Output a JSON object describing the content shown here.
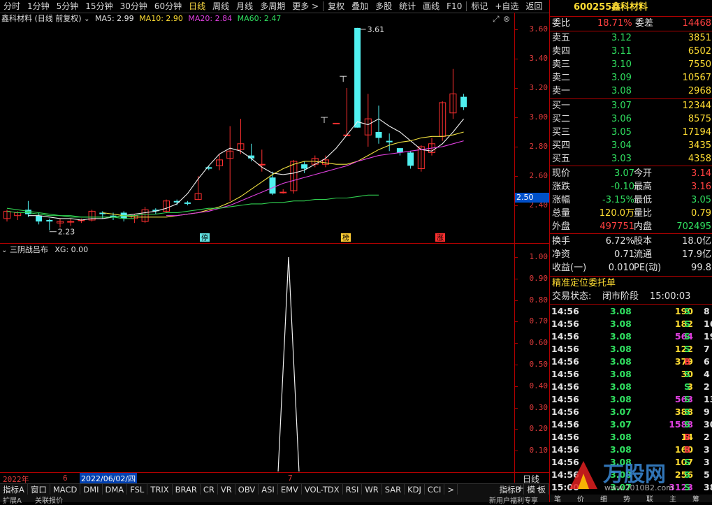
{
  "toolbar": {
    "items": [
      "分时",
      "1分钟",
      "5分钟",
      "15分钟",
      "30分钟",
      "60分钟",
      "日线",
      "周线",
      "月线",
      "多周期",
      "更多 >",
      "复权",
      "叠加",
      "多股",
      "统计",
      "画线",
      "F10",
      "标记",
      "+自选",
      "返回"
    ],
    "active": "日线"
  },
  "main_legend": {
    "title": "鑫科材料 (日线 前复权)",
    "ma5": "MA5: 2.99",
    "ma10": "MA10: 2.90",
    "ma20": "MA20: 2.84",
    "ma60": "MA60: 2.47"
  },
  "main_axis": [
    "3.60",
    "3.40",
    "3.20",
    "3.00",
    "2.80",
    "2.60",
    "2.40"
  ],
  "current_price_tag": "2.50",
  "annotations": {
    "high": "3.61",
    "low": "2.23",
    "tag1": "停",
    "tag2": "榜",
    "tag3": "涨"
  },
  "sub_legend": {
    "title": "三阴战吕布",
    "value": "XG: 0.00"
  },
  "sub_axis": [
    "1.00",
    "0.90",
    "0.80",
    "0.70",
    "0.60",
    "0.50",
    "0.40",
    "0.30",
    "0.20",
    "0.10"
  ],
  "date_bar": {
    "year": "2022年",
    "m1": "6",
    "date": "2022/06/02/四",
    "m2": "7",
    "period": "日线"
  },
  "indicator_tabs": [
    "指标A",
    "窗口",
    "MACD",
    "DMI",
    "DMA",
    "FSL",
    "TRIX",
    "BRAR",
    "CR",
    "VR",
    "OBV",
    "ASI",
    "EMV",
    "VOL-TDX",
    "RSI",
    "WR",
    "SAR",
    "KDJ",
    "CCI",
    ">",
    "指标B",
    "模 板"
  ],
  "status_bar": {
    "left": "扩展A",
    "mid": "关联报价",
    "right": "新用户福利专享"
  },
  "quote": {
    "code": "600255",
    "name": "鑫科材料",
    "webi_label": "委比",
    "webi": "18.71%",
    "wecha_label": "委差",
    "wecha": "14468",
    "asks": [
      {
        "label": "卖五",
        "price": "3.12",
        "vol": "3851"
      },
      {
        "label": "卖四",
        "price": "3.11",
        "vol": "6502"
      },
      {
        "label": "卖三",
        "price": "3.10",
        "vol": "7550"
      },
      {
        "label": "卖二",
        "price": "3.09",
        "vol": "10567"
      },
      {
        "label": "卖一",
        "price": "3.08",
        "vol": "2968"
      }
    ],
    "bids": [
      {
        "label": "买一",
        "price": "3.07",
        "vol": "12344"
      },
      {
        "label": "买二",
        "price": "3.06",
        "vol": "8575"
      },
      {
        "label": "买三",
        "price": "3.05",
        "vol": "17194"
      },
      {
        "label": "买四",
        "price": "3.04",
        "vol": "3435"
      },
      {
        "label": "买五",
        "price": "3.03",
        "vol": "4358"
      }
    ],
    "stats": [
      {
        "l1": "现价",
        "v1": "3.07",
        "c1": "green",
        "l2": "今开",
        "v2": "3.14",
        "c2": "red"
      },
      {
        "l1": "涨跌",
        "v1": "-0.10",
        "c1": "green",
        "l2": "最高",
        "v2": "3.16",
        "c2": "red"
      },
      {
        "l1": "涨幅",
        "v1": "-3.15%",
        "c1": "green",
        "l2": "最低",
        "v2": "3.05",
        "c2": "green"
      },
      {
        "l1": "总量",
        "v1": "120.0万",
        "c1": "yellow",
        "l2": "量比",
        "v2": "0.79",
        "c2": "yellow"
      },
      {
        "l1": "外盘",
        "v1": "497751",
        "c1": "red",
        "l2": "内盘",
        "v2": "702495",
        "c2": "green"
      }
    ],
    "stats2": [
      {
        "l1": "换手",
        "v1": "6.72%",
        "l2": "股本",
        "v2": "18.0亿"
      },
      {
        "l1": "净资",
        "v1": "0.71",
        "l2": "流通",
        "v2": "17.9亿"
      },
      {
        "l1": "收益(一)",
        "v1": "0.010",
        "l2": "PE(动)",
        "v2": "99.8"
      }
    ],
    "order_title": "精准定位委托单",
    "trade_status_label": "交易状态:",
    "trade_status": "闭市阶段",
    "trade_time": "15:00:03",
    "ticks": [
      {
        "t": "14:56",
        "p": "3.08",
        "v": "190",
        "vc": "yellow",
        "d": "S",
        "n": "8"
      },
      {
        "t": "14:56",
        "p": "3.08",
        "v": "182",
        "vc": "yellow",
        "d": "S",
        "n": "16"
      },
      {
        "t": "14:56",
        "p": "3.08",
        "v": "564",
        "vc": "magenta",
        "d": "S",
        "n": "19"
      },
      {
        "t": "14:56",
        "p": "3.08",
        "v": "122",
        "vc": "yellow",
        "d": "S",
        "n": "7"
      },
      {
        "t": "14:56",
        "p": "3.08",
        "v": "379",
        "vc": "yellow",
        "d": "B",
        "n": "6"
      },
      {
        "t": "14:56",
        "p": "3.08",
        "v": "30",
        "vc": "yellow",
        "d": "S",
        "n": "4"
      },
      {
        "t": "14:56",
        "p": "3.08",
        "v": "3",
        "vc": "yellow",
        "d": "S",
        "n": "2"
      },
      {
        "t": "14:56",
        "p": "3.08",
        "v": "563",
        "vc": "magenta",
        "d": "S",
        "n": "13"
      },
      {
        "t": "14:56",
        "p": "3.07",
        "v": "388",
        "vc": "yellow",
        "d": "S",
        "n": "9"
      },
      {
        "t": "14:56",
        "p": "3.07",
        "v": "1588",
        "vc": "magenta",
        "d": "S",
        "n": "30"
      },
      {
        "t": "14:56",
        "p": "3.08",
        "v": "14",
        "vc": "yellow",
        "d": "B",
        "n": "2"
      },
      {
        "t": "14:56",
        "p": "3.08",
        "v": "160",
        "vc": "yellow",
        "d": "B",
        "n": "3"
      },
      {
        "t": "14:56",
        "p": "3.08",
        "v": "107",
        "vc": "yellow",
        "d": "S",
        "n": "3"
      },
      {
        "t": "14:56",
        "p": "3.08",
        "v": "256",
        "vc": "yellow",
        "d": "S",
        "n": "5"
      },
      {
        "t": "15:00",
        "p": "3.07",
        "v": "3123",
        "vc": "magenta",
        "d": "S",
        "n": "385"
      }
    ],
    "bottom_tabs": [
      "笔",
      "价",
      "细",
      "势",
      "联",
      "主",
      "筹"
    ]
  },
  "watermark": {
    "brand": "万股网",
    "url": "www.2010B2.com"
  }
}
